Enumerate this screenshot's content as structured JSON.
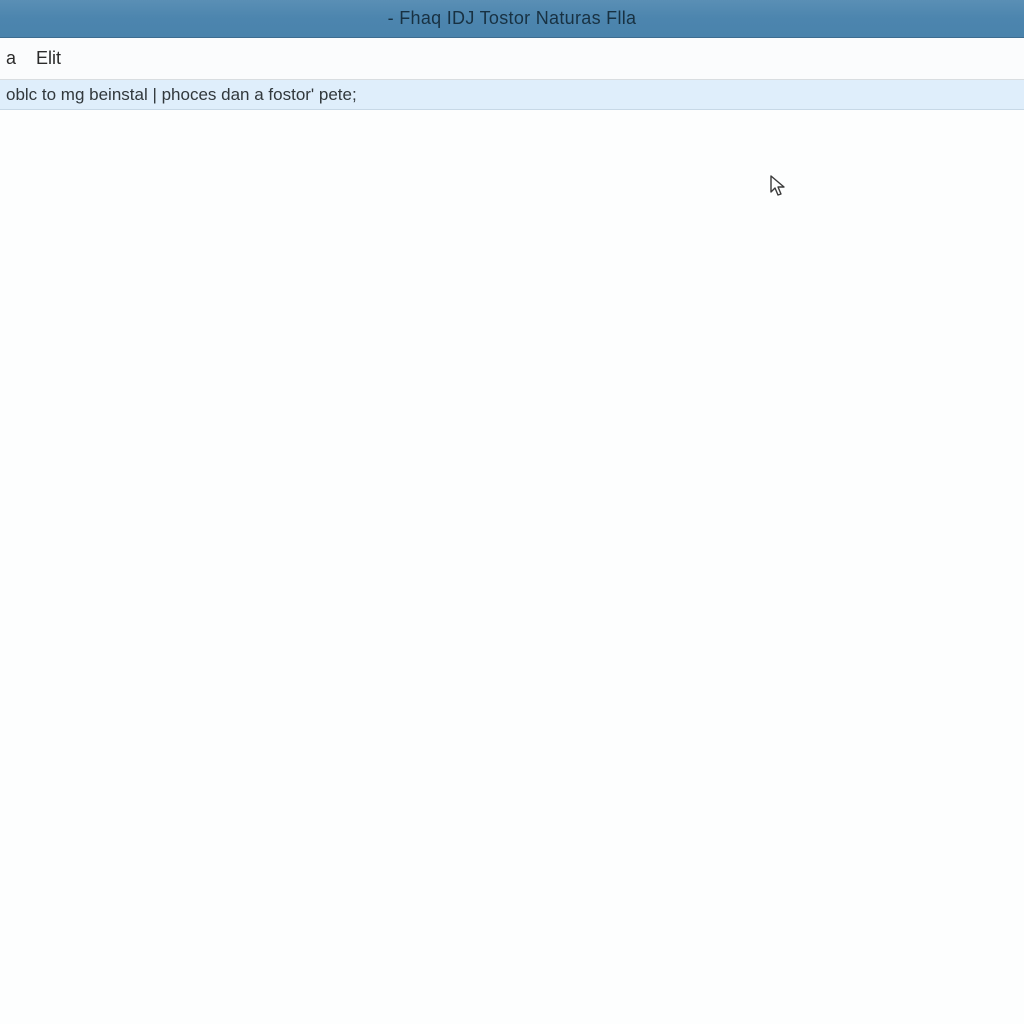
{
  "window": {
    "title": "- Fhaq IDJ Tostor Naturas Flla"
  },
  "menubar": {
    "items": [
      {
        "label": "a"
      },
      {
        "label": "Elit"
      }
    ]
  },
  "toolbar": {
    "text": "oblc to mg beinstal | phoces dan a fostor' pete;"
  }
}
